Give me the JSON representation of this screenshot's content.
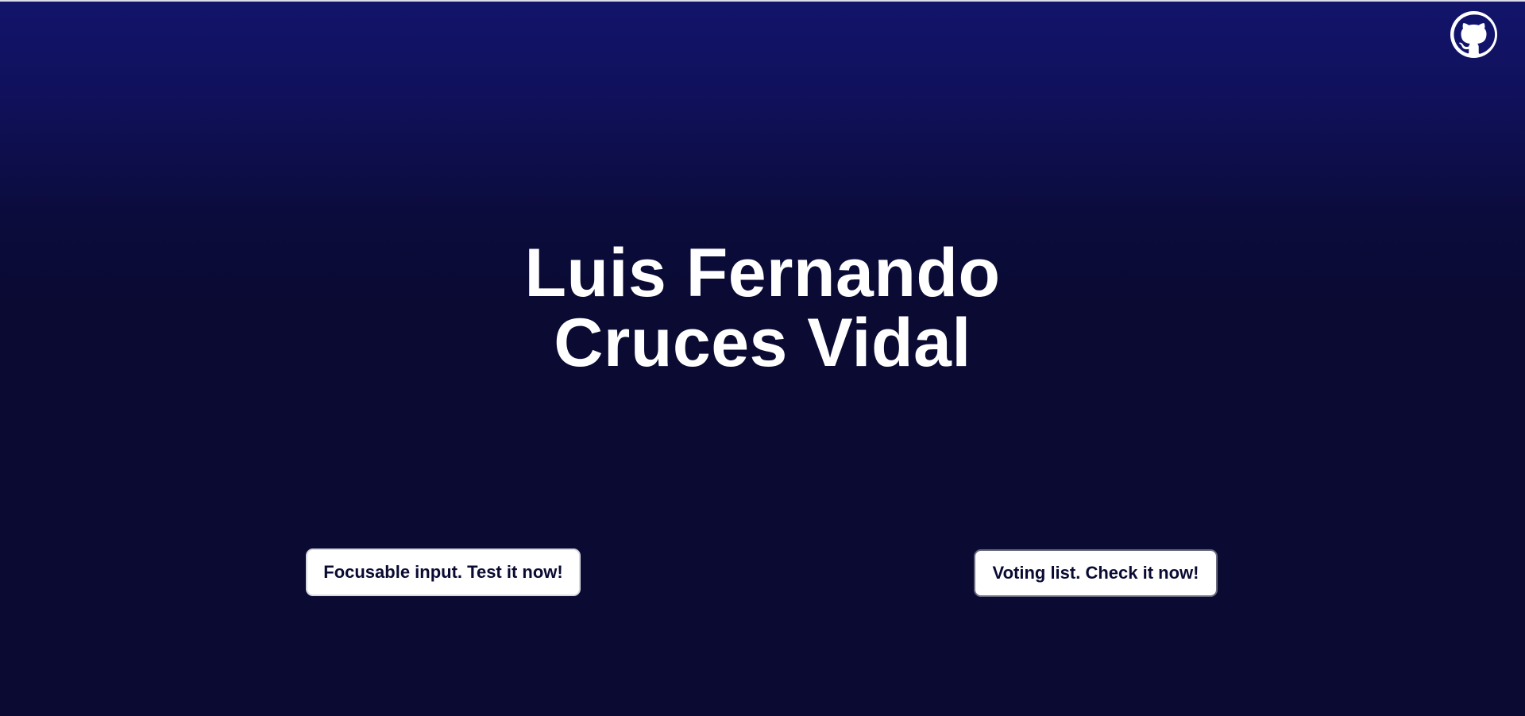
{
  "colors": {
    "background_top": "#12146b",
    "background_bottom": "#0a0a33",
    "text_primary": "#ffffff",
    "button_bg": "#ffffff",
    "button_text": "#0a0a33"
  },
  "header": {
    "github_link": {
      "icon": "github-icon"
    }
  },
  "hero": {
    "title_line1": "Luis Fernando",
    "title_line2": "Cruces Vidal"
  },
  "actions": {
    "focusable_input_label": "Focusable input. Test it now!",
    "voting_list_label": "Voting list. Check it now!"
  }
}
